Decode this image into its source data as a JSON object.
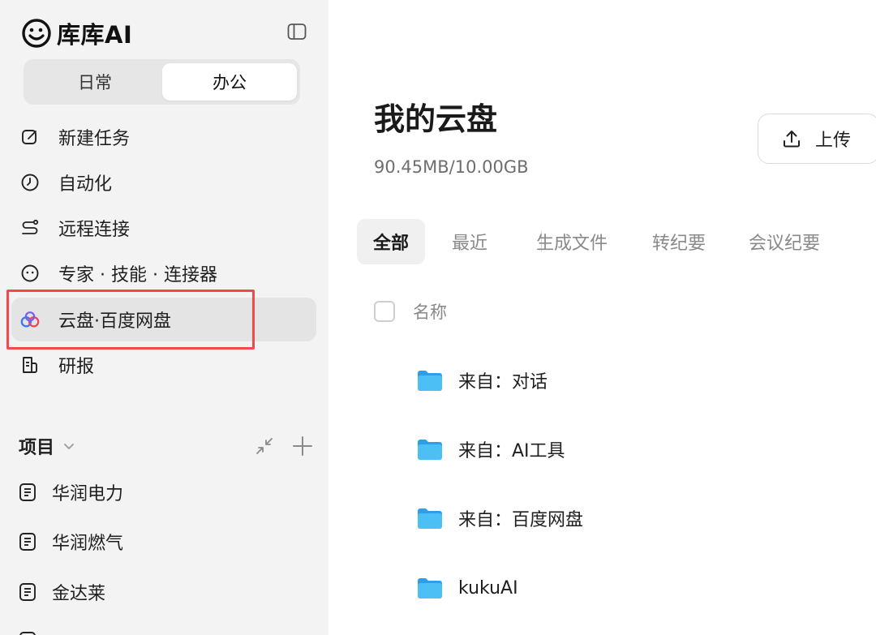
{
  "sidebar": {
    "brand": {
      "name": "库库AI",
      "logo_icon": "smiley-logo-icon"
    },
    "toggle_icon": "sidebar-toggle-icon",
    "modes": [
      "日常",
      "办公"
    ],
    "active_mode": "办公",
    "nav": [
      {
        "label": "新建任务",
        "icon": "edit-icon"
      },
      {
        "label": "自动化",
        "icon": "clock-icon"
      },
      {
        "label": "远程连接",
        "icon": "route-icon"
      },
      {
        "label": "专家 · 技能 · 连接器",
        "icon": "smiley-icon"
      },
      {
        "label": "云盘·百度网盘",
        "icon": "baidu-cloud-icon"
      },
      {
        "label": "研报",
        "icon": "report-icon"
      }
    ],
    "active_nav": "云盘·百度网盘",
    "projects": {
      "title": "项目",
      "items": [
        {
          "label": "华润电力"
        },
        {
          "label": "华润燃气"
        },
        {
          "label": "金达莱"
        }
      ]
    }
  },
  "main": {
    "title": "我的云盘",
    "storage": "90.45MB/10.00GB",
    "upload_label": "上传",
    "tabs": [
      "全部",
      "最近",
      "生成文件",
      "转纪要",
      "会议纪要"
    ],
    "active_tab": "全部",
    "column_name": "名称",
    "files": [
      {
        "name": "来自：对话"
      },
      {
        "name": "来自：AI工具"
      },
      {
        "name": "来自：百度网盘"
      },
      {
        "name": "kukuAI"
      }
    ]
  },
  "colors": {
    "sidebar_bg": "#f3f3f3",
    "highlight": "#ef4b4b",
    "folder": "#3eb4f0"
  }
}
